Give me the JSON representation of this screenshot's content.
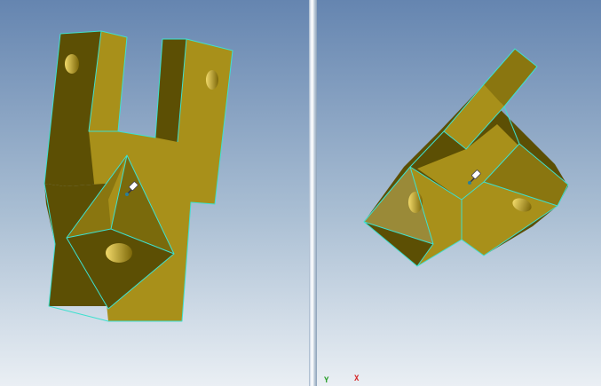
{
  "viewports": {
    "right": {
      "axis_triad": {
        "y_label": "Y",
        "x_label": "X"
      }
    }
  },
  "colors": {
    "part_face_light": "#a8901a",
    "part_face_mid": "#8a7610",
    "part_face_dark": "#5c4f04",
    "edge_highlight": "#3ee0cf",
    "background_top": "#6585b0",
    "background_bottom": "#eaeff4",
    "axis_y": "#2ca02c",
    "axis_x": "#d62728"
  },
  "icons": {
    "cursor": "pushpin-icon"
  }
}
